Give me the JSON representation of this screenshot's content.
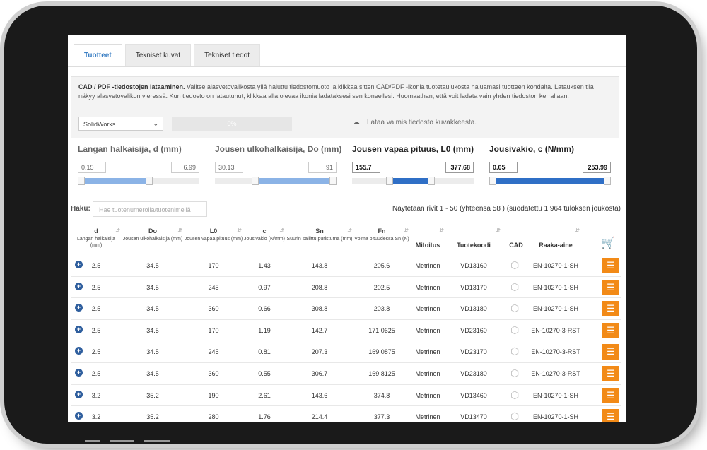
{
  "tabs": [
    {
      "label": "Tuotteet",
      "active": true
    },
    {
      "label": "Tekniset kuvat",
      "active": false
    },
    {
      "label": "Tekniset tiedot",
      "active": false
    }
  ],
  "info": {
    "title": "CAD / PDF -tiedostojen lataaminen.",
    "text": "Valitse alasvetovalikosta yllä haluttu tiedostomuoto ja klikkaa sitten CAD/PDF -ikonia tuotetaulukosta haluamasi tuotteen kohdalta. Latauksen tila näkyy alasvetovalikon vieressä. Kun tiedosto on latautunut, klikkaa alla olevaa ikonia ladataksesi sen koneellesi. Huomaathan, että voit ladata vain yhden tiedoston kerrallaan.",
    "format_selected": "SolidWorks",
    "progress": "0%",
    "download_text": "Lataa valmis tiedosto kuvakkeesta."
  },
  "filters": [
    {
      "label": "Langan halkaisija, d (mm)",
      "min": "0.15",
      "max": "6.99",
      "from": 0.0,
      "to": 0.56
    },
    {
      "label": "Jousen ulkohalkaisija, Do (mm)",
      "min": "30.13",
      "max": "91",
      "from": 0.3,
      "to": 1.0
    },
    {
      "label": "Jousen vapaa pituus, L0 (mm)",
      "min": "155.7",
      "max": "377.68",
      "from": 0.28,
      "to": 0.62
    },
    {
      "label": "Jousivakio, c (N/mm)",
      "min": "0.05",
      "max": "253.99",
      "from": 0.0,
      "to": 1.0
    }
  ],
  "search": {
    "label": "Haku:",
    "placeholder": "Hae tuotenumerolla/tuotenimellä"
  },
  "showing": "Näytetään rivit 1 - 50 (yhteensä 58 ) (suodatettu 1,964 tuloksen joukosta)",
  "columns": [
    {
      "key": "d",
      "title": "d",
      "sub": "Langan halkaisija (mm)"
    },
    {
      "key": "do",
      "title": "Do",
      "sub": "Jousen ulkohalkaisija (mm)"
    },
    {
      "key": "l0",
      "title": "L0",
      "sub": "Jousen vapaa pituus (mm)"
    },
    {
      "key": "c",
      "title": "c",
      "sub": "Jousivakio (N/mm)"
    },
    {
      "key": "sn",
      "title": "Sn",
      "sub": "Suurin sallittu puristuma (mm)"
    },
    {
      "key": "fn",
      "title": "Fn",
      "sub": "Voima pituudessa Sn (N)"
    },
    {
      "key": "mit",
      "title": "Mitoitus",
      "sub": ""
    },
    {
      "key": "code",
      "title": "Tuotekoodi",
      "sub": ""
    },
    {
      "key": "cad",
      "title": "CAD",
      "sub": ""
    },
    {
      "key": "mat",
      "title": "Raaka-aine",
      "sub": ""
    }
  ],
  "rows": [
    {
      "d": "2.5",
      "do": "34.5",
      "l0": "170",
      "c": "1.43",
      "sn": "143.8",
      "fn": "205.6",
      "mit": "Metrinen",
      "code": "VD13160",
      "mat": "EN-10270-1-SH"
    },
    {
      "d": "2.5",
      "do": "34.5",
      "l0": "245",
      "c": "0.97",
      "sn": "208.8",
      "fn": "202.5",
      "mit": "Metrinen",
      "code": "VD13170",
      "mat": "EN-10270-1-SH"
    },
    {
      "d": "2.5",
      "do": "34.5",
      "l0": "360",
      "c": "0.66",
      "sn": "308.8",
      "fn": "203.8",
      "mit": "Metrinen",
      "code": "VD13180",
      "mat": "EN-10270-1-SH"
    },
    {
      "d": "2.5",
      "do": "34.5",
      "l0": "170",
      "c": "1.19",
      "sn": "142.7",
      "fn": "171.0625",
      "mit": "Metrinen",
      "code": "VD23160",
      "mat": "EN-10270-3-RST"
    },
    {
      "d": "2.5",
      "do": "34.5",
      "l0": "245",
      "c": "0.81",
      "sn": "207.3",
      "fn": "169.0875",
      "mit": "Metrinen",
      "code": "VD23170",
      "mat": "EN-10270-3-RST"
    },
    {
      "d": "2.5",
      "do": "34.5",
      "l0": "360",
      "c": "0.55",
      "sn": "306.7",
      "fn": "169.8125",
      "mit": "Metrinen",
      "code": "VD23180",
      "mat": "EN-10270-3-RST"
    },
    {
      "d": "3.2",
      "do": "35.2",
      "l0": "190",
      "c": "2.61",
      "sn": "143.6",
      "fn": "374.8",
      "mit": "Metrinen",
      "code": "VD13460",
      "mat": "EN-10270-1-SH"
    },
    {
      "d": "3.2",
      "do": "35.2",
      "l0": "280",
      "c": "1.76",
      "sn": "214.4",
      "fn": "377.3",
      "mit": "Metrinen",
      "code": "VD13470",
      "mat": "EN-10270-1-SH"
    }
  ],
  "icons": {
    "expand": "plus-circle-icon",
    "cad": "cube-icon",
    "pdf": "document-icon",
    "cart": "cart-icon",
    "cloud": "cloud-download-icon"
  },
  "colors": {
    "accent": "#3b7fc4",
    "pdf": "#f28a17",
    "slider": "#2f6fc6"
  }
}
